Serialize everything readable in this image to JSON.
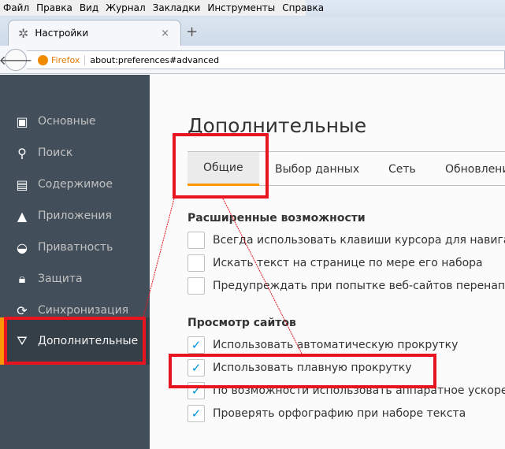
{
  "menu": [
    "Файл",
    "Правка",
    "Вид",
    "Журнал",
    "Закладки",
    "Инструменты",
    "Справка"
  ],
  "tab": {
    "title": "Настройки",
    "close": "×",
    "new": "+"
  },
  "url": {
    "identity": "Firefox",
    "address": "about:preferences#advanced"
  },
  "sidebar": [
    {
      "label": "Основные",
      "icon": "general-icon"
    },
    {
      "label": "Поиск",
      "icon": "search-icon"
    },
    {
      "label": "Содержимое",
      "icon": "content-icon"
    },
    {
      "label": "Приложения",
      "icon": "applications-icon"
    },
    {
      "label": "Приватность",
      "icon": "privacy-mask-icon"
    },
    {
      "label": "Защита",
      "icon": "security-lock-icon"
    },
    {
      "label": "Синхронизация",
      "icon": "sync-icon"
    },
    {
      "label": "Дополнительные",
      "icon": "advanced-wizard-hat-icon"
    }
  ],
  "page": {
    "title": "Дополнительные",
    "tabs": [
      "Общие",
      "Выбор данных",
      "Сеть",
      "Обновлени"
    ],
    "sections": [
      {
        "title": "Расширенные возможности",
        "items": [
          {
            "label": "Всегда использовать клавиши курсора для навигаци",
            "checked": false
          },
          {
            "label": "Искать текст на странице по мере его набора",
            "checked": false
          },
          {
            "label": "Предупреждать при попытке веб-сайтов перенаправ",
            "checked": false
          }
        ]
      },
      {
        "title": "Просмотр сайтов",
        "items": [
          {
            "label": "Использовать автоматическую прокрутку",
            "checked": true
          },
          {
            "label": "Использовать плавную прокрутку",
            "checked": true
          },
          {
            "label": "По возможности использовать аппаратное ускорени",
            "checked": true
          },
          {
            "label": "Проверять орфографию при наборе текста",
            "checked": true
          }
        ]
      }
    ]
  },
  "colors": {
    "accent": "#ff9500",
    "sidebar": "#424f5a",
    "annotation": "#e8141f",
    "check": "#0095dd"
  }
}
